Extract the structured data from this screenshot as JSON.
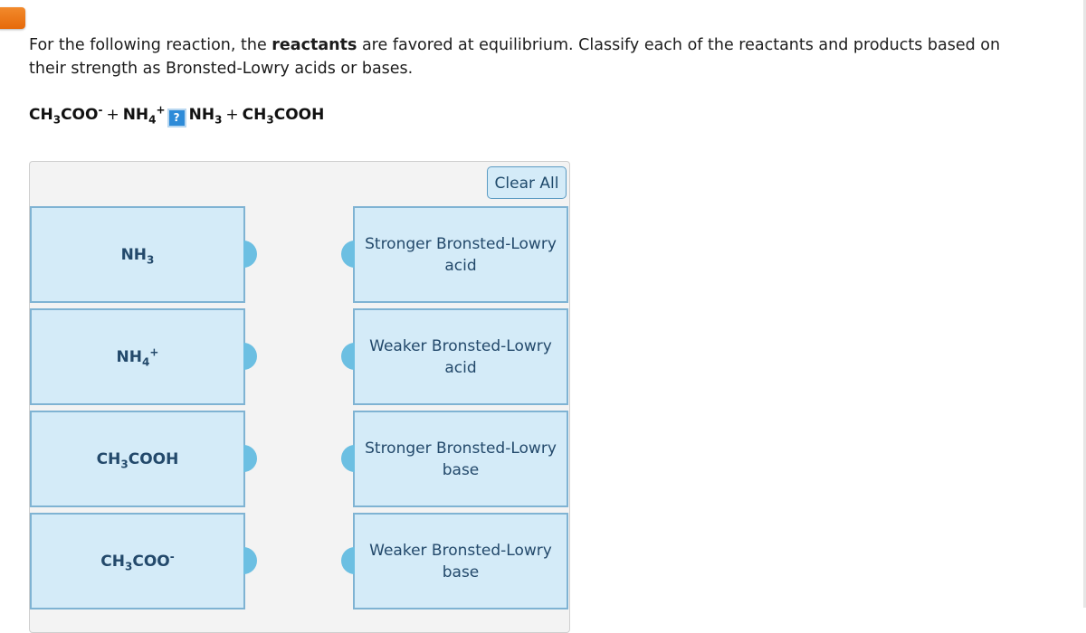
{
  "question": {
    "text_before": "For the following reaction, the ",
    "bold": "reactants",
    "text_after": " are favored at equilibrium. Classify each of the reactants and products based on their strength as Bronsted-Lowry acids or bases."
  },
  "equation": {
    "r1_main": "CH",
    "r1_sub": "3",
    "r1_rest": "COO",
    "r1_sup": "-",
    "plus1": "+",
    "r2_main": "NH",
    "r2_sub": "4",
    "r2_sup": "+",
    "arrow_icon": "?",
    "p1_main": "NH",
    "p1_sub": "3",
    "plus2": "+",
    "p2_main": "CH",
    "p2_sub": "3",
    "p2_rest": "COOH"
  },
  "panel": {
    "clear_all_label": "Clear All"
  },
  "species": [
    {
      "main": "NH",
      "sub": "3",
      "rest": "",
      "sup": ""
    },
    {
      "main": "NH",
      "sub": "4",
      "rest": "",
      "sup": "+"
    },
    {
      "main": "CH",
      "sub": "3",
      "rest": "COOH",
      "sup": ""
    },
    {
      "main": "CH",
      "sub": "3",
      "rest": "COO",
      "sup": "-"
    }
  ],
  "categories": [
    {
      "label": "Stronger Bronsted-Lowry acid"
    },
    {
      "label": "Weaker Bronsted-Lowry acid"
    },
    {
      "label": "Stronger Bronsted-Lowry base"
    },
    {
      "label": "Weaker Bronsted-Lowry base"
    }
  ],
  "colors": {
    "accent_orange": "#e66a0a",
    "box_fill": "#d4ebf8",
    "box_border": "#7fb3d3",
    "knob": "#6cbfe2",
    "text_dark_blue": "#23496b"
  }
}
